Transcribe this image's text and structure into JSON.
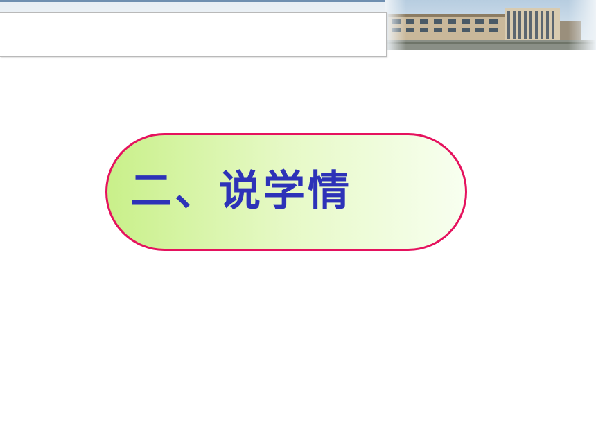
{
  "slide": {
    "heading": "二、说学情"
  },
  "colors": {
    "pill_border": "#e5125e",
    "pill_fill_start": "#c9f08a",
    "pill_fill_end": "#f8fff0",
    "heading_text": "#2d32b8",
    "banner_line": "#6f8fb0"
  },
  "icons": {
    "header_image": "school-building-photo"
  }
}
